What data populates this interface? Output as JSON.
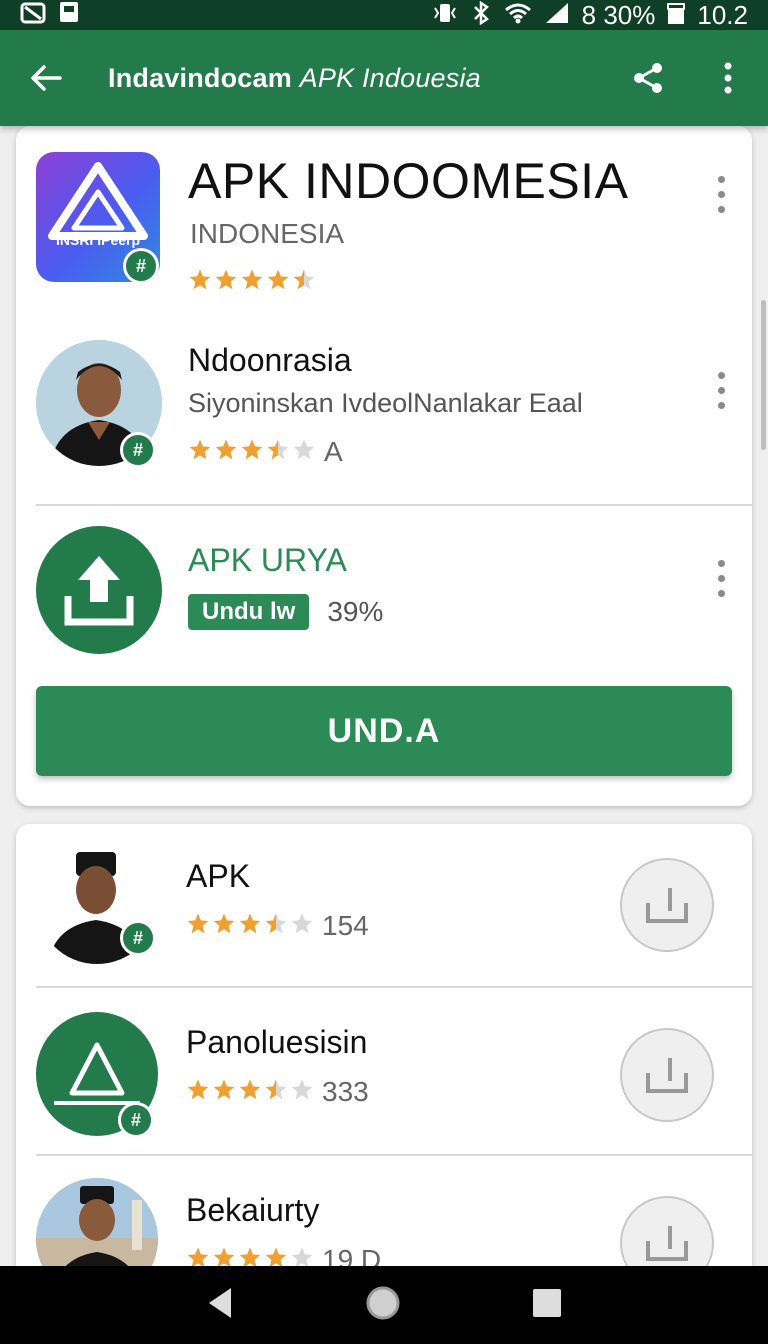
{
  "status_bar": {
    "battery_text": "8 30%",
    "time": "10.2"
  },
  "app_bar": {
    "title_bold": "Indavindocam",
    "title_italic": "APK Indouesia"
  },
  "featured": {
    "title": "APK INDOOMESIA",
    "subtitle": "INDONESIA",
    "logo_text": "INSRI IPeerp",
    "rating": 4.5
  },
  "developer": {
    "name": "Ndoonrasia",
    "description": "Siyoninskan IvdeolNanlakar Eaal",
    "rating": 3.5,
    "rating_suffix": "A"
  },
  "download": {
    "name": "APK URYA",
    "chip_label": "Undu lw",
    "progress_text": "39%",
    "progress": 0.39,
    "button_label": "UND.A"
  },
  "list": [
    {
      "title": "APK",
      "rating": 3.5,
      "count": "154"
    },
    {
      "title": "Panoluesisin",
      "rating": 3.5,
      "count": "333"
    },
    {
      "title": "Bekaiurty",
      "rating": 4,
      "count": "19 D"
    }
  ],
  "colors": {
    "primary": "#237a4b",
    "status_bar": "#0f3f27",
    "star": "#f0a030"
  }
}
